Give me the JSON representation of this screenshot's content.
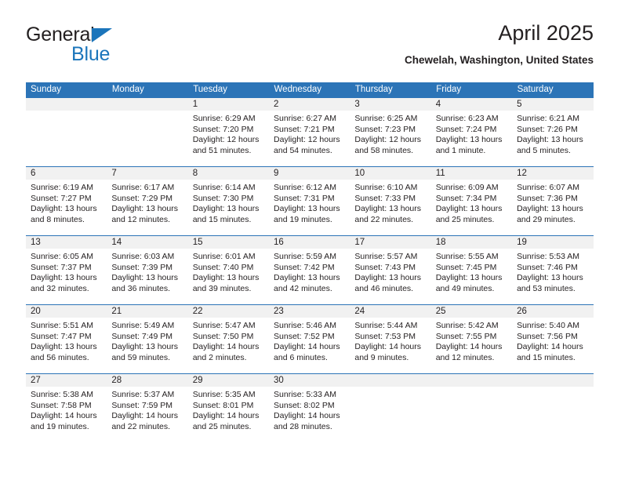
{
  "brand": {
    "name_top": "General",
    "name_bottom": "Blue",
    "accent_color": "#1b75bb"
  },
  "header": {
    "title": "April 2025",
    "subtitle": "Chewelah, Washington, United States"
  },
  "theme": {
    "header_blue": "#2c74b7",
    "day_band_gray": "#f1f1f1",
    "text": "#231f20"
  },
  "weekday_headers": [
    "Sunday",
    "Monday",
    "Tuesday",
    "Wednesday",
    "Thursday",
    "Friday",
    "Saturday"
  ],
  "labels": {
    "sunrise_prefix": "Sunrise:",
    "sunset_prefix": "Sunset:",
    "daylight_prefix": "Daylight:"
  },
  "weeks": [
    [
      {
        "day": "",
        "line1": "",
        "line2": "",
        "line3": "",
        "line4": ""
      },
      {
        "day": "",
        "line1": "",
        "line2": "",
        "line3": "",
        "line4": ""
      },
      {
        "day": "1",
        "line1": "Sunrise: 6:29 AM",
        "line2": "Sunset: 7:20 PM",
        "line3": "Daylight: 12 hours",
        "line4": "and 51 minutes."
      },
      {
        "day": "2",
        "line1": "Sunrise: 6:27 AM",
        "line2": "Sunset: 7:21 PM",
        "line3": "Daylight: 12 hours",
        "line4": "and 54 minutes."
      },
      {
        "day": "3",
        "line1": "Sunrise: 6:25 AM",
        "line2": "Sunset: 7:23 PM",
        "line3": "Daylight: 12 hours",
        "line4": "and 58 minutes."
      },
      {
        "day": "4",
        "line1": "Sunrise: 6:23 AM",
        "line2": "Sunset: 7:24 PM",
        "line3": "Daylight: 13 hours",
        "line4": "and 1 minute."
      },
      {
        "day": "5",
        "line1": "Sunrise: 6:21 AM",
        "line2": "Sunset: 7:26 PM",
        "line3": "Daylight: 13 hours",
        "line4": "and 5 minutes."
      }
    ],
    [
      {
        "day": "6",
        "line1": "Sunrise: 6:19 AM",
        "line2": "Sunset: 7:27 PM",
        "line3": "Daylight: 13 hours",
        "line4": "and 8 minutes."
      },
      {
        "day": "7",
        "line1": "Sunrise: 6:17 AM",
        "line2": "Sunset: 7:29 PM",
        "line3": "Daylight: 13 hours",
        "line4": "and 12 minutes."
      },
      {
        "day": "8",
        "line1": "Sunrise: 6:14 AM",
        "line2": "Sunset: 7:30 PM",
        "line3": "Daylight: 13 hours",
        "line4": "and 15 minutes."
      },
      {
        "day": "9",
        "line1": "Sunrise: 6:12 AM",
        "line2": "Sunset: 7:31 PM",
        "line3": "Daylight: 13 hours",
        "line4": "and 19 minutes."
      },
      {
        "day": "10",
        "line1": "Sunrise: 6:10 AM",
        "line2": "Sunset: 7:33 PM",
        "line3": "Daylight: 13 hours",
        "line4": "and 22 minutes."
      },
      {
        "day": "11",
        "line1": "Sunrise: 6:09 AM",
        "line2": "Sunset: 7:34 PM",
        "line3": "Daylight: 13 hours",
        "line4": "and 25 minutes."
      },
      {
        "day": "12",
        "line1": "Sunrise: 6:07 AM",
        "line2": "Sunset: 7:36 PM",
        "line3": "Daylight: 13 hours",
        "line4": "and 29 minutes."
      }
    ],
    [
      {
        "day": "13",
        "line1": "Sunrise: 6:05 AM",
        "line2": "Sunset: 7:37 PM",
        "line3": "Daylight: 13 hours",
        "line4": "and 32 minutes."
      },
      {
        "day": "14",
        "line1": "Sunrise: 6:03 AM",
        "line2": "Sunset: 7:39 PM",
        "line3": "Daylight: 13 hours",
        "line4": "and 36 minutes."
      },
      {
        "day": "15",
        "line1": "Sunrise: 6:01 AM",
        "line2": "Sunset: 7:40 PM",
        "line3": "Daylight: 13 hours",
        "line4": "and 39 minutes."
      },
      {
        "day": "16",
        "line1": "Sunrise: 5:59 AM",
        "line2": "Sunset: 7:42 PM",
        "line3": "Daylight: 13 hours",
        "line4": "and 42 minutes."
      },
      {
        "day": "17",
        "line1": "Sunrise: 5:57 AM",
        "line2": "Sunset: 7:43 PM",
        "line3": "Daylight: 13 hours",
        "line4": "and 46 minutes."
      },
      {
        "day": "18",
        "line1": "Sunrise: 5:55 AM",
        "line2": "Sunset: 7:45 PM",
        "line3": "Daylight: 13 hours",
        "line4": "and 49 minutes."
      },
      {
        "day": "19",
        "line1": "Sunrise: 5:53 AM",
        "line2": "Sunset: 7:46 PM",
        "line3": "Daylight: 13 hours",
        "line4": "and 53 minutes."
      }
    ],
    [
      {
        "day": "20",
        "line1": "Sunrise: 5:51 AM",
        "line2": "Sunset: 7:47 PM",
        "line3": "Daylight: 13 hours",
        "line4": "and 56 minutes."
      },
      {
        "day": "21",
        "line1": "Sunrise: 5:49 AM",
        "line2": "Sunset: 7:49 PM",
        "line3": "Daylight: 13 hours",
        "line4": "and 59 minutes."
      },
      {
        "day": "22",
        "line1": "Sunrise: 5:47 AM",
        "line2": "Sunset: 7:50 PM",
        "line3": "Daylight: 14 hours",
        "line4": "and 2 minutes."
      },
      {
        "day": "23",
        "line1": "Sunrise: 5:46 AM",
        "line2": "Sunset: 7:52 PM",
        "line3": "Daylight: 14 hours",
        "line4": "and 6 minutes."
      },
      {
        "day": "24",
        "line1": "Sunrise: 5:44 AM",
        "line2": "Sunset: 7:53 PM",
        "line3": "Daylight: 14 hours",
        "line4": "and 9 minutes."
      },
      {
        "day": "25",
        "line1": "Sunrise: 5:42 AM",
        "line2": "Sunset: 7:55 PM",
        "line3": "Daylight: 14 hours",
        "line4": "and 12 minutes."
      },
      {
        "day": "26",
        "line1": "Sunrise: 5:40 AM",
        "line2": "Sunset: 7:56 PM",
        "line3": "Daylight: 14 hours",
        "line4": "and 15 minutes."
      }
    ],
    [
      {
        "day": "27",
        "line1": "Sunrise: 5:38 AM",
        "line2": "Sunset: 7:58 PM",
        "line3": "Daylight: 14 hours",
        "line4": "and 19 minutes."
      },
      {
        "day": "28",
        "line1": "Sunrise: 5:37 AM",
        "line2": "Sunset: 7:59 PM",
        "line3": "Daylight: 14 hours",
        "line4": "and 22 minutes."
      },
      {
        "day": "29",
        "line1": "Sunrise: 5:35 AM",
        "line2": "Sunset: 8:01 PM",
        "line3": "Daylight: 14 hours",
        "line4": "and 25 minutes."
      },
      {
        "day": "30",
        "line1": "Sunrise: 5:33 AM",
        "line2": "Sunset: 8:02 PM",
        "line3": "Daylight: 14 hours",
        "line4": "and 28 minutes."
      },
      {
        "day": "",
        "line1": "",
        "line2": "",
        "line3": "",
        "line4": ""
      },
      {
        "day": "",
        "line1": "",
        "line2": "",
        "line3": "",
        "line4": ""
      },
      {
        "day": "",
        "line1": "",
        "line2": "",
        "line3": "",
        "line4": ""
      }
    ]
  ]
}
